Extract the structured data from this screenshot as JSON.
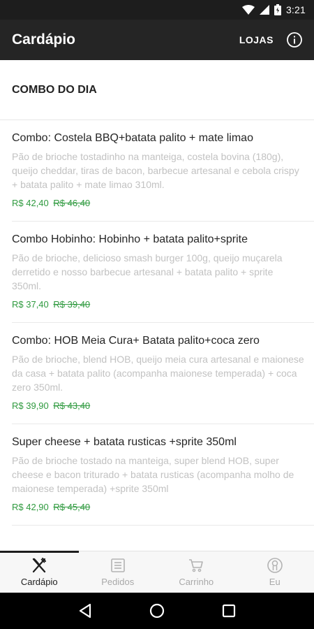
{
  "status_bar": {
    "time": "3:21",
    "icons": [
      "wifi-icon",
      "cell-signal-icon",
      "battery-icon"
    ]
  },
  "app_bar": {
    "title": "Cardápio",
    "lojas_label": "LOJAS",
    "info_icon": "info-icon"
  },
  "section": {
    "title": "COMBO DO DIA"
  },
  "items": [
    {
      "title": "Combo: Costela BBQ+batata palito + mate limao",
      "description": "Pão de brioche tostadinho na manteiga, costela bovina (180g), queijo cheddar, tiras de bacon, barbecue artesanal e cebola crispy + batata palito + mate limao 310ml.",
      "price": "R$ 42,40",
      "old_price": "R$ 46,40"
    },
    {
      "title": "Combo Hobinho: Hobinho + batata palito+sprite",
      "description": "Pão de brioche, delicioso smash burger 100g, queijo muçarela derretido e nosso barbecue artesanal + batata palito + sprite 350ml.",
      "price": "R$ 37,40",
      "old_price": "R$ 39,40"
    },
    {
      "title": "Combo: HOB Meia Cura+ Batata palito+coca zero",
      "description": "Pão de brioche, blend HOB, queijo meia cura artesanal e maionese da casa + batata palito (acompanha maionese temperada) + coca zero 350ml.",
      "price": "R$ 39,90",
      "old_price": "R$ 43,40"
    },
    {
      "title": "Super cheese + batata rusticas +sprite 350ml",
      "description": "Pão de brioche tostado na manteiga, super blend HOB, super cheese e bacon triturado + batata rusticas (acompanha molho de maionese temperada) +sprite 350ml",
      "price": "R$ 42,90",
      "old_price": "R$ 45,40"
    }
  ],
  "bottom_nav": {
    "items": [
      {
        "label": "Cardápio",
        "icon": "fork-knife-icon",
        "active": true
      },
      {
        "label": "Pedidos",
        "icon": "receipt-icon",
        "active": false
      },
      {
        "label": "Carrinho",
        "icon": "cart-icon",
        "active": false
      },
      {
        "label": "Eu",
        "icon": "profile-icon",
        "active": false
      }
    ]
  },
  "system_nav": {
    "icons": [
      "back-icon",
      "home-icon",
      "recents-icon"
    ]
  },
  "colors": {
    "app_bar": "#252525",
    "status_bar": "#1d1d1d",
    "price": "#2f9a3f",
    "description": "#c2c2c2"
  }
}
